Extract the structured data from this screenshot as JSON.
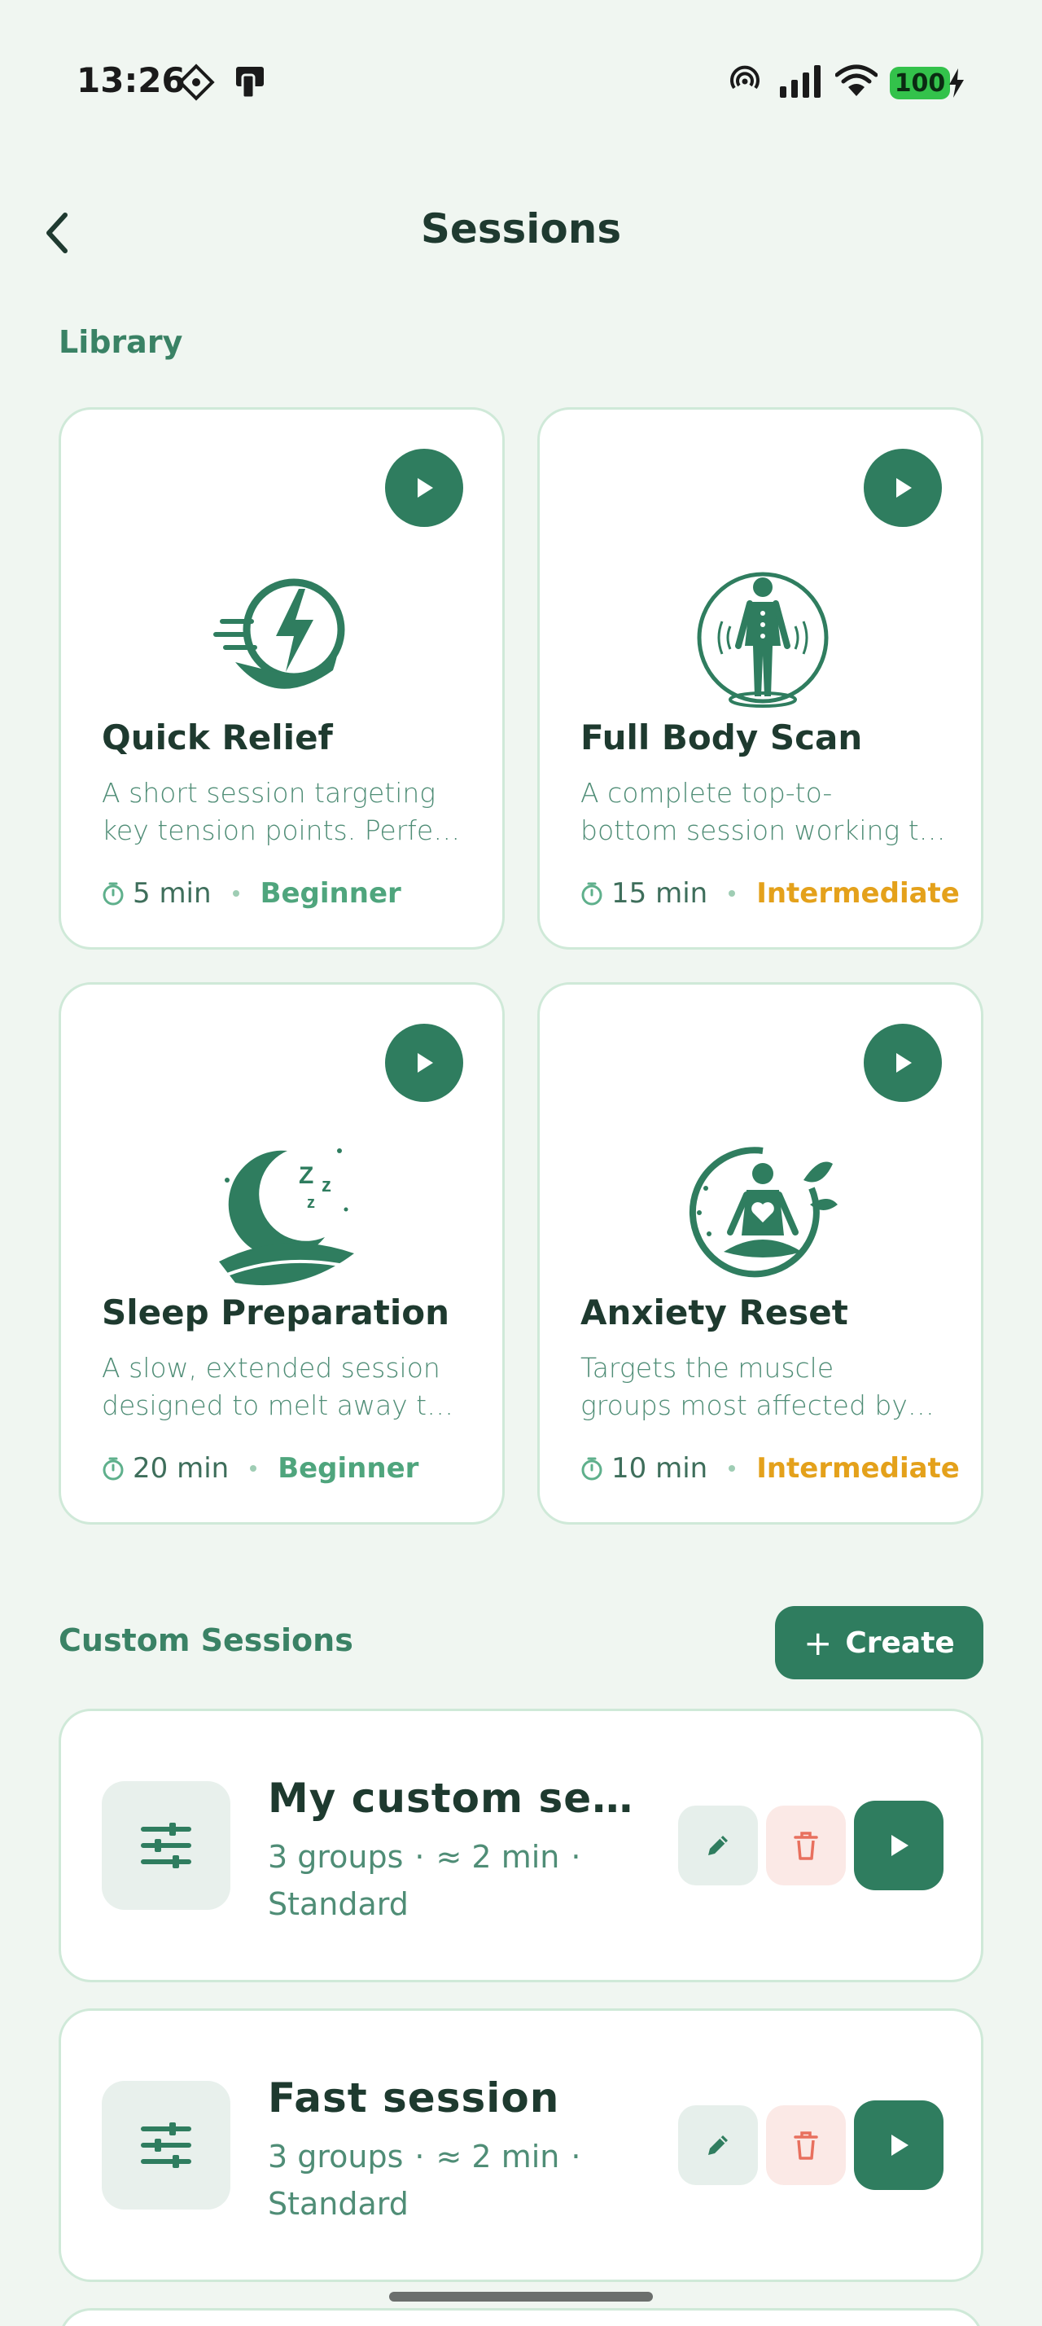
{
  "status_bar": {
    "time": "13:26",
    "battery": "100"
  },
  "header": {
    "title": "Sessions"
  },
  "library": {
    "label": "Library",
    "cards": [
      {
        "title": "Quick Relief",
        "desc_line1": "A short session targeting",
        "desc_line2": "key tension points. Perfe…",
        "duration": "5 min",
        "level": "Beginner",
        "icon": "lightning-leaf-icon"
      },
      {
        "title": "Full Body Scan",
        "desc_line1": "A complete top-to-",
        "desc_line2": "bottom session working t…",
        "duration": "15 min",
        "level": "Intermediate",
        "icon": "body-scan-icon"
      },
      {
        "title": "Sleep Preparation",
        "desc_line1": "A slow, extended session",
        "desc_line2": "designed to melt away t…",
        "duration": "20 min",
        "level": "Beginner",
        "icon": "moon-sleep-icon"
      },
      {
        "title": "Anxiety Reset",
        "desc_line1": "Targets the muscle",
        "desc_line2": "groups most affected by…",
        "duration": "10 min",
        "level": "Intermediate",
        "icon": "meditation-heart-icon"
      }
    ]
  },
  "custom": {
    "label": "Custom Sessions",
    "create_label": "Create",
    "items": [
      {
        "title": "My custom session",
        "groups": "3 groups",
        "duration": "≈ 2 min",
        "mode": "Standard"
      },
      {
        "title": "Fast session",
        "groups": "3 groups",
        "duration": "≈ 2 min",
        "mode": "Standard"
      }
    ]
  },
  "colors": {
    "background": "#F0F6F1",
    "primary": "#2F7D5F",
    "beginner": "#4FA57D",
    "intermediate": "#E4A11B",
    "delete": "#E8705E"
  }
}
